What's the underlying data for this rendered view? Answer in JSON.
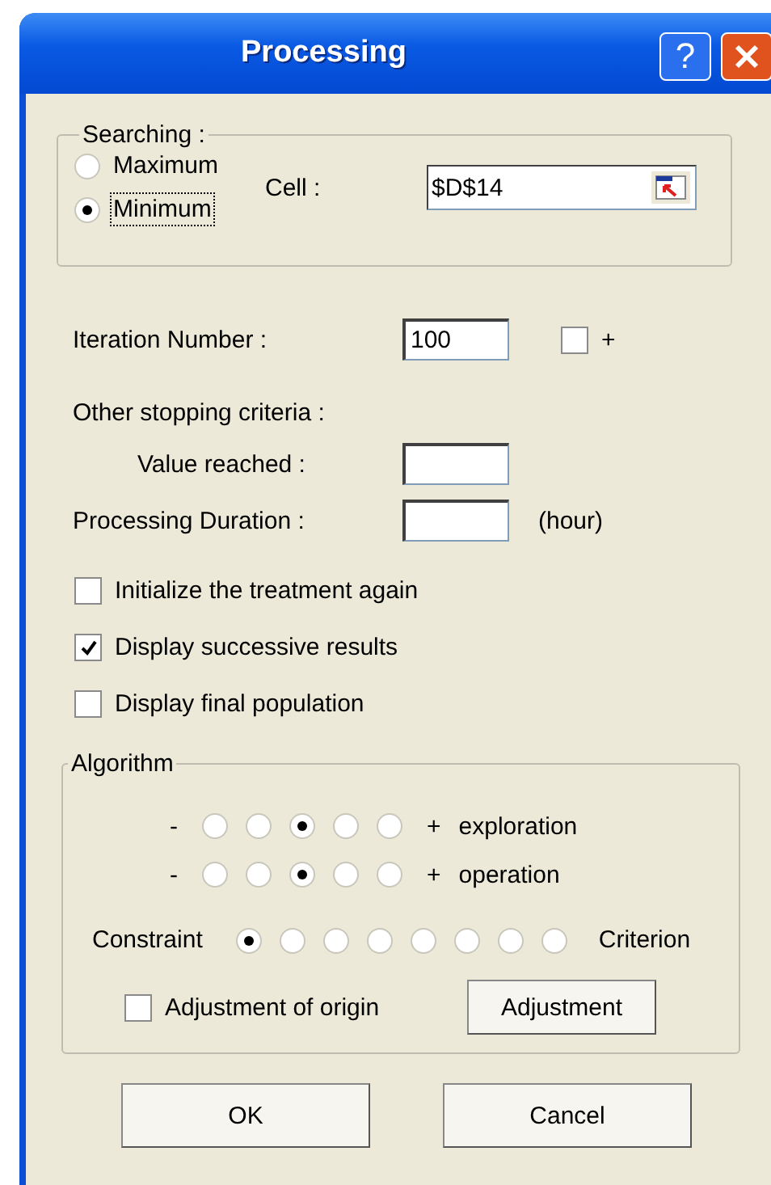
{
  "window": {
    "title": "Processing",
    "help": "?"
  },
  "searching": {
    "legend": "Searching :",
    "options": [
      {
        "label": "Maximum",
        "selected": false,
        "focused": false
      },
      {
        "label": "Minimum",
        "selected": true,
        "focused": true
      }
    ],
    "cell": {
      "label": "Cell :",
      "value": "$D$14"
    }
  },
  "iteration": {
    "label": "Iteration Number :",
    "value": "100",
    "extra": {
      "label": "+",
      "checked": false
    }
  },
  "stopping": {
    "heading": "Other stopping criteria :",
    "value_reached": {
      "label": "Value reached :"
    },
    "duration": {
      "label": "Processing Duration :",
      "unit": "(hour)"
    }
  },
  "checkboxes": [
    {
      "label": "Initialize the treatment again",
      "checked": false
    },
    {
      "label": "Display successive results",
      "checked": true
    },
    {
      "label": "Display final population",
      "checked": false
    }
  ],
  "algorithm": {
    "legend": "Algorithm",
    "scales": [
      {
        "minus": "-",
        "plus": "+",
        "label": "exploration",
        "options": [
          {
            "selected": false
          },
          {
            "selected": false
          },
          {
            "selected": true
          },
          {
            "selected": false
          },
          {
            "selected": false
          }
        ]
      },
      {
        "minus": "-",
        "plus": "+",
        "label": "operation",
        "options": [
          {
            "selected": false
          },
          {
            "selected": false
          },
          {
            "selected": true
          },
          {
            "selected": false
          },
          {
            "selected": false
          }
        ]
      }
    ],
    "balance": {
      "left": "Constraint",
      "right": "Criterion",
      "options": [
        {
          "selected": true
        },
        {
          "selected": false
        },
        {
          "selected": false
        },
        {
          "selected": false
        },
        {
          "selected": false
        },
        {
          "selected": false
        },
        {
          "selected": false
        },
        {
          "selected": false
        }
      ]
    },
    "origin": {
      "label": "Adjustment of origin",
      "checked": false
    },
    "button": "Adjustment"
  },
  "buttons": [
    "OK",
    "Cancel"
  ]
}
